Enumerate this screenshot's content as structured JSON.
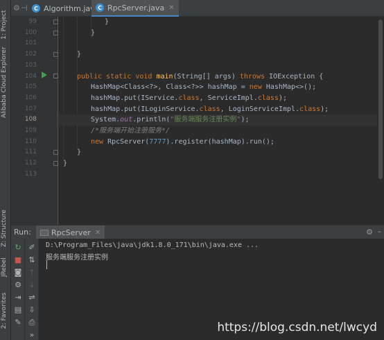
{
  "left_strip": {
    "project_label": "1: Project",
    "cloud_label": "Alibaba Cloud Explorer",
    "structure_label": "Z: Structure",
    "jrebel_label": "JRebel",
    "favorites_label": "2: Favorites"
  },
  "tabs": [
    {
      "label": "Algorithm.java",
      "active": false
    },
    {
      "label": "RpcServer.java",
      "active": true
    }
  ],
  "editor": {
    "line_numbers": [
      "99",
      "100",
      "101",
      "102",
      "103",
      "104",
      "105",
      "106",
      "107",
      "108",
      "109",
      "110",
      "111",
      "112",
      "113"
    ],
    "current_line": "108",
    "code": {
      "l99": "}",
      "l100": "}",
      "l102": "}",
      "l104_public": "public",
      "l104_static": "static",
      "l104_void": "void",
      "l104_method": "main",
      "l104_params": "(String[] args)",
      "l104_throws": "throws",
      "l104_exc": "IOException {",
      "l105_a": "HashMap<Class<?>, Class<?>> hashMap = ",
      "l105_new": "new",
      "l105_b": " HashMap<>();",
      "l106_a": "hashMap.put(IService.",
      "l106_class1": "class",
      "l106_b": ", ServiceImpl.",
      "l106_class2": "class",
      "l106_c": ");",
      "l107_a": "hashMap.put(ILoginService.",
      "l107_class1": "class",
      "l107_b": ", LoginServiceImpl.",
      "l107_class2": "class",
      "l107_c": ");",
      "l108_a": "System.",
      "l108_out": "out",
      "l108_b": ".println(",
      "l108_str": "\"服务端服务注册实例\"",
      "l108_c": ");",
      "l109_comment": "/*服务端开始注册服务*/",
      "l110_new": "new",
      "l110_a": " RpcServer(",
      "l110_num": "7777",
      "l110_b": ").register(hashMap).run();",
      "l111": "}",
      "l112": "}"
    }
  },
  "run_panel": {
    "title": "Run:",
    "tab_label": "RpcServer",
    "console_lines": [
      "D:\\Program_Files\\java\\jdk1.8.0_171\\bin\\java.exe ...",
      "服务端服务注册实例"
    ]
  },
  "watermark": "https://blog.csdn.net/lwcyd",
  "colors": {
    "background": "#2b2b2b",
    "keyword": "#cc7832",
    "string": "#6a8759",
    "number": "#6897bb",
    "method": "#ffc66d",
    "field": "#9876aa",
    "comment": "#808080"
  }
}
